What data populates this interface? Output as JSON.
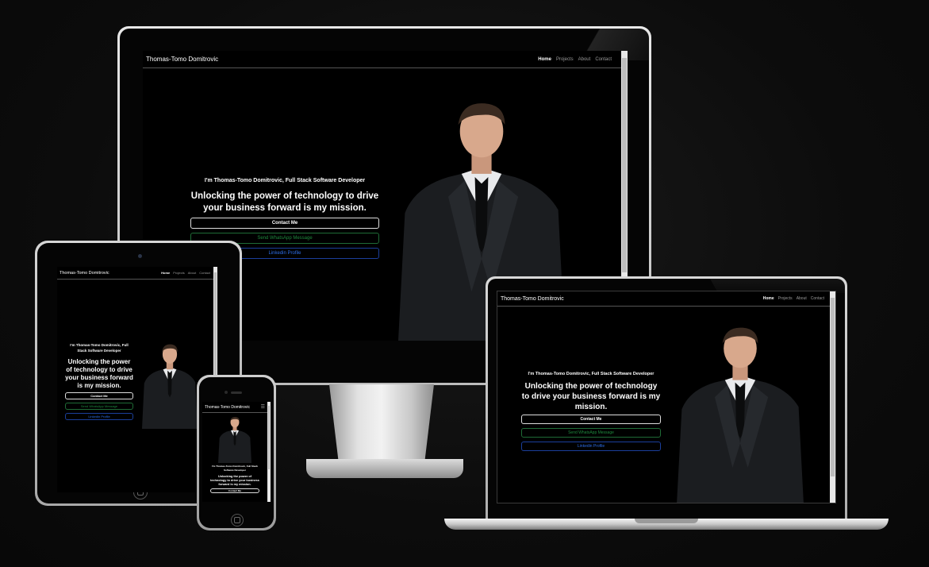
{
  "site": {
    "brand": "Thomas-Tomo Domitrovic",
    "nav": [
      {
        "label": "Home",
        "active": true
      },
      {
        "label": "Projects",
        "active": false
      },
      {
        "label": "About",
        "active": false
      },
      {
        "label": "Contact",
        "active": false
      }
    ],
    "intro": "I'm Thomas-Tomo Domitrovic, Full Stack Software Developer",
    "headline": "Unlocking the power of technology to drive your business forward is my mission.",
    "buttons": {
      "contact": "Contact Me",
      "whatsapp": "Send WhatsApp Message",
      "linkedin": "Linkedin Profile"
    }
  },
  "colors": {
    "background": "#0c0c0c",
    "whatsapp": "#1e8a3e",
    "linkedin": "#2d6ee8"
  },
  "icons": {
    "phone_menu": "hamburger-menu-icon"
  }
}
